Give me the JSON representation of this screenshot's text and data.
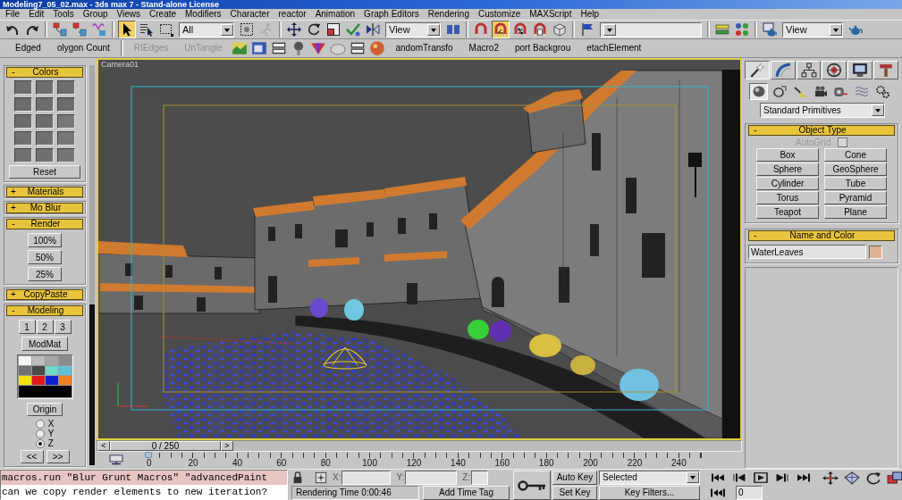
{
  "window": {
    "title": "Modeling7_05_02.max - 3ds max 7 - Stand-alone License"
  },
  "menu_bar": [
    "File",
    "Edit",
    "Tools",
    "Group",
    "Views",
    "Create",
    "Modifiers",
    "Character",
    "reactor",
    "Animation",
    "Graph Editors",
    "Rendering",
    "Customize",
    "MAXScript",
    "Help"
  ],
  "main_toolbar": [
    {
      "kind": "tool",
      "selected": false
    },
    {
      "kind": "tool",
      "selected": false
    },
    {
      "kind": "separator"
    },
    {
      "kind": "tool",
      "selected": false
    },
    {
      "kind": "tool",
      "selected": false
    },
    {
      "kind": "tool",
      "selected": false
    },
    {
      "kind": "separator"
    },
    {
      "kind": "tool",
      "selected": true
    },
    {
      "kind": "tool",
      "selected": false
    },
    {
      "kind": "tool",
      "selected": false
    },
    {
      "kind": "dropdown",
      "value": "All"
    },
    {
      "kind": "tool",
      "selected": false
    },
    {
      "kind": "tool",
      "selected": false
    },
    {
      "kind": "separator"
    },
    {
      "kind": "tool",
      "selected": false
    },
    {
      "kind": "tool",
      "selected": false
    },
    {
      "kind": "tool",
      "selected": false
    },
    {
      "kind": "tool",
      "selected": false
    },
    {
      "kind": "tool",
      "selected": false
    },
    {
      "kind": "dropdown",
      "value": "View"
    },
    {
      "kind": "tool",
      "selected": false
    },
    {
      "kind": "separator"
    },
    {
      "kind": "tool",
      "selected": false
    },
    {
      "kind": "tool",
      "selected": true
    },
    {
      "kind": "tool",
      "selected": false
    },
    {
      "kind": "tool",
      "selected": false
    },
    {
      "kind": "tool",
      "selected": false
    },
    {
      "kind": "separator"
    },
    {
      "kind": "tool",
      "selected": false
    },
    {
      "kind": "dropdown"
    },
    {
      "kind": "separator"
    },
    {
      "kind": "tool",
      "selected": false
    },
    {
      "kind": "tool",
      "selected": false
    },
    {
      "kind": "separator"
    },
    {
      "kind": "tool",
      "selected": false
    },
    {
      "kind": "dropdown",
      "value": "View"
    },
    {
      "kind": "tool",
      "selected": false
    }
  ],
  "macro_toolbar": [
    {
      "kind": "button",
      "label": "Edged",
      "disabled": false
    },
    {
      "kind": "button",
      "label": "olygon Count",
      "disabled": false
    },
    {
      "kind": "separator"
    },
    {
      "kind": "button",
      "label": "RIEdges",
      "disabled": true
    },
    {
      "kind": "button",
      "label": "UnTangle",
      "disabled": true
    },
    {
      "kind": "tool"
    },
    {
      "kind": "tool"
    },
    {
      "kind": "tool"
    },
    {
      "kind": "tool"
    },
    {
      "kind": "tool"
    },
    {
      "kind": "tool"
    },
    {
      "kind": "tool"
    },
    {
      "kind": "tool"
    },
    {
      "kind": "button",
      "label": "andomTransfo",
      "disabled": false
    },
    {
      "kind": "button",
      "label": "Macro2",
      "disabled": false
    },
    {
      "kind": "button",
      "label": "port Backgrou",
      "disabled": false
    },
    {
      "kind": "button",
      "label": "etachElement",
      "disabled": false
    }
  ],
  "left_panel": {
    "rollouts": [
      {
        "kind": "colors",
        "toggle": "-",
        "title": "Colors",
        "swatches": [
          {
            "color": "#6e6e6e"
          },
          {
            "color": "#6e6e6e"
          },
          {
            "color": "#6e6e6e"
          },
          {
            "color": "#6c6c6c"
          },
          {
            "color": "#6c6c6c"
          },
          {
            "color": "#6c6c6c"
          },
          {
            "color": "#6c6c6c"
          },
          {
            "color": "#6c6c6c"
          },
          {
            "color": "#787878"
          },
          {
            "color": "#707070"
          },
          {
            "color": "#707070"
          },
          {
            "color": "#767676"
          },
          {
            "color": "#707070"
          },
          {
            "color": "#707070"
          },
          {
            "color": "#767676"
          }
        ],
        "button": "Reset"
      },
      {
        "kind": "plain",
        "toggle": "+",
        "title": "Materials"
      },
      {
        "kind": "plain",
        "toggle": "+",
        "title": "Mo Blur"
      },
      {
        "kind": "buttons",
        "toggle": "-",
        "title": "Render",
        "buttons": [
          "100%",
          "50%",
          "25%"
        ]
      },
      {
        "kind": "plain",
        "toggle": "+",
        "title": "CopyPaste"
      },
      {
        "kind": "modeling",
        "toggle": "-",
        "title": "Modeling",
        "number_buttons": [
          "1",
          "2",
          "3"
        ],
        "button": "ModMat",
        "palette": [
          {
            "color": "#f4f4f4"
          },
          {
            "color": "#bdbdbd"
          },
          {
            "color": "#a6a6a6"
          },
          {
            "color": "#8a8a8a"
          },
          {
            "color": "#707070"
          },
          {
            "color": "#484848"
          },
          {
            "color": "#70d8c8"
          },
          {
            "color": "#60c0d8"
          },
          {
            "color": "#f0e010"
          },
          {
            "color": "#e01818"
          },
          {
            "color": "#1020d0"
          },
          {
            "color": "#f08020"
          },
          {
            "color": "#000000"
          }
        ],
        "origin_button": "Origin",
        "axes": [
          {
            "label": "X",
            "selected": false
          },
          {
            "label": "Y",
            "selected": false
          },
          {
            "label": "Z",
            "selected": true
          }
        ],
        "nav_buttons": [
          "<<",
          ">>"
        ]
      }
    ]
  },
  "viewport": {
    "label": "Camera01",
    "active": true
  },
  "time_slider": {
    "prev": "<",
    "position": "0 / 250",
    "next": ">",
    "level": 0
  },
  "track_bar": {
    "ticks": [
      "0",
      "20",
      "40",
      "60",
      "80",
      "100",
      "120",
      "140",
      "160",
      "180",
      "200",
      "220",
      "240"
    ]
  },
  "command_panel": {
    "tabs": [
      {
        "selected": true
      },
      {
        "selected": false
      },
      {
        "selected": false
      },
      {
        "selected": false
      },
      {
        "selected": false
      },
      {
        "selected": false
      }
    ],
    "categories": [
      {
        "selected": true
      },
      {
        "selected": false
      },
      {
        "selected": false
      },
      {
        "selected": false
      },
      {
        "selected": false
      },
      {
        "selected": false
      },
      {
        "selected": false
      }
    ],
    "type_dropdown": "Standard Primitives",
    "object_type": {
      "toggle": "-",
      "title": "Object Type",
      "autogrid": {
        "label": "AutoGrid",
        "checked": false,
        "disabled": true
      },
      "buttons": [
        "Box",
        "Cone",
        "Sphere",
        "GeoSphere",
        "Cylinder",
        "Tube",
        "Torus",
        "Pyramid",
        "Teapot",
        "Plane"
      ]
    },
    "name_and_color": {
      "toggle": "-",
      "title": "Name and Color",
      "name": "WaterLeaves",
      "color": "#e0b294"
    }
  },
  "status_bar": {
    "listener": [
      {
        "kind": "macro",
        "text": "macros.run \"Blur Grunt Macros\" \"advancedPaint"
      },
      {
        "kind": "output",
        "text": "can we copy render elements to new iteration?"
      }
    ],
    "coordinates": [
      {
        "label": "X:"
      },
      {
        "label": "Y:"
      },
      {
        "label": "Z:"
      }
    ],
    "prompt": "Rendering Time 0:00:46",
    "time_tag": "Add Time Tag"
  },
  "animation_controls": {
    "auto_key": {
      "label": "Auto Key",
      "on": false
    },
    "key_set": "Selected",
    "set_key": "Set Key",
    "key_filters": "Key Filters...",
    "frame": "0"
  }
}
